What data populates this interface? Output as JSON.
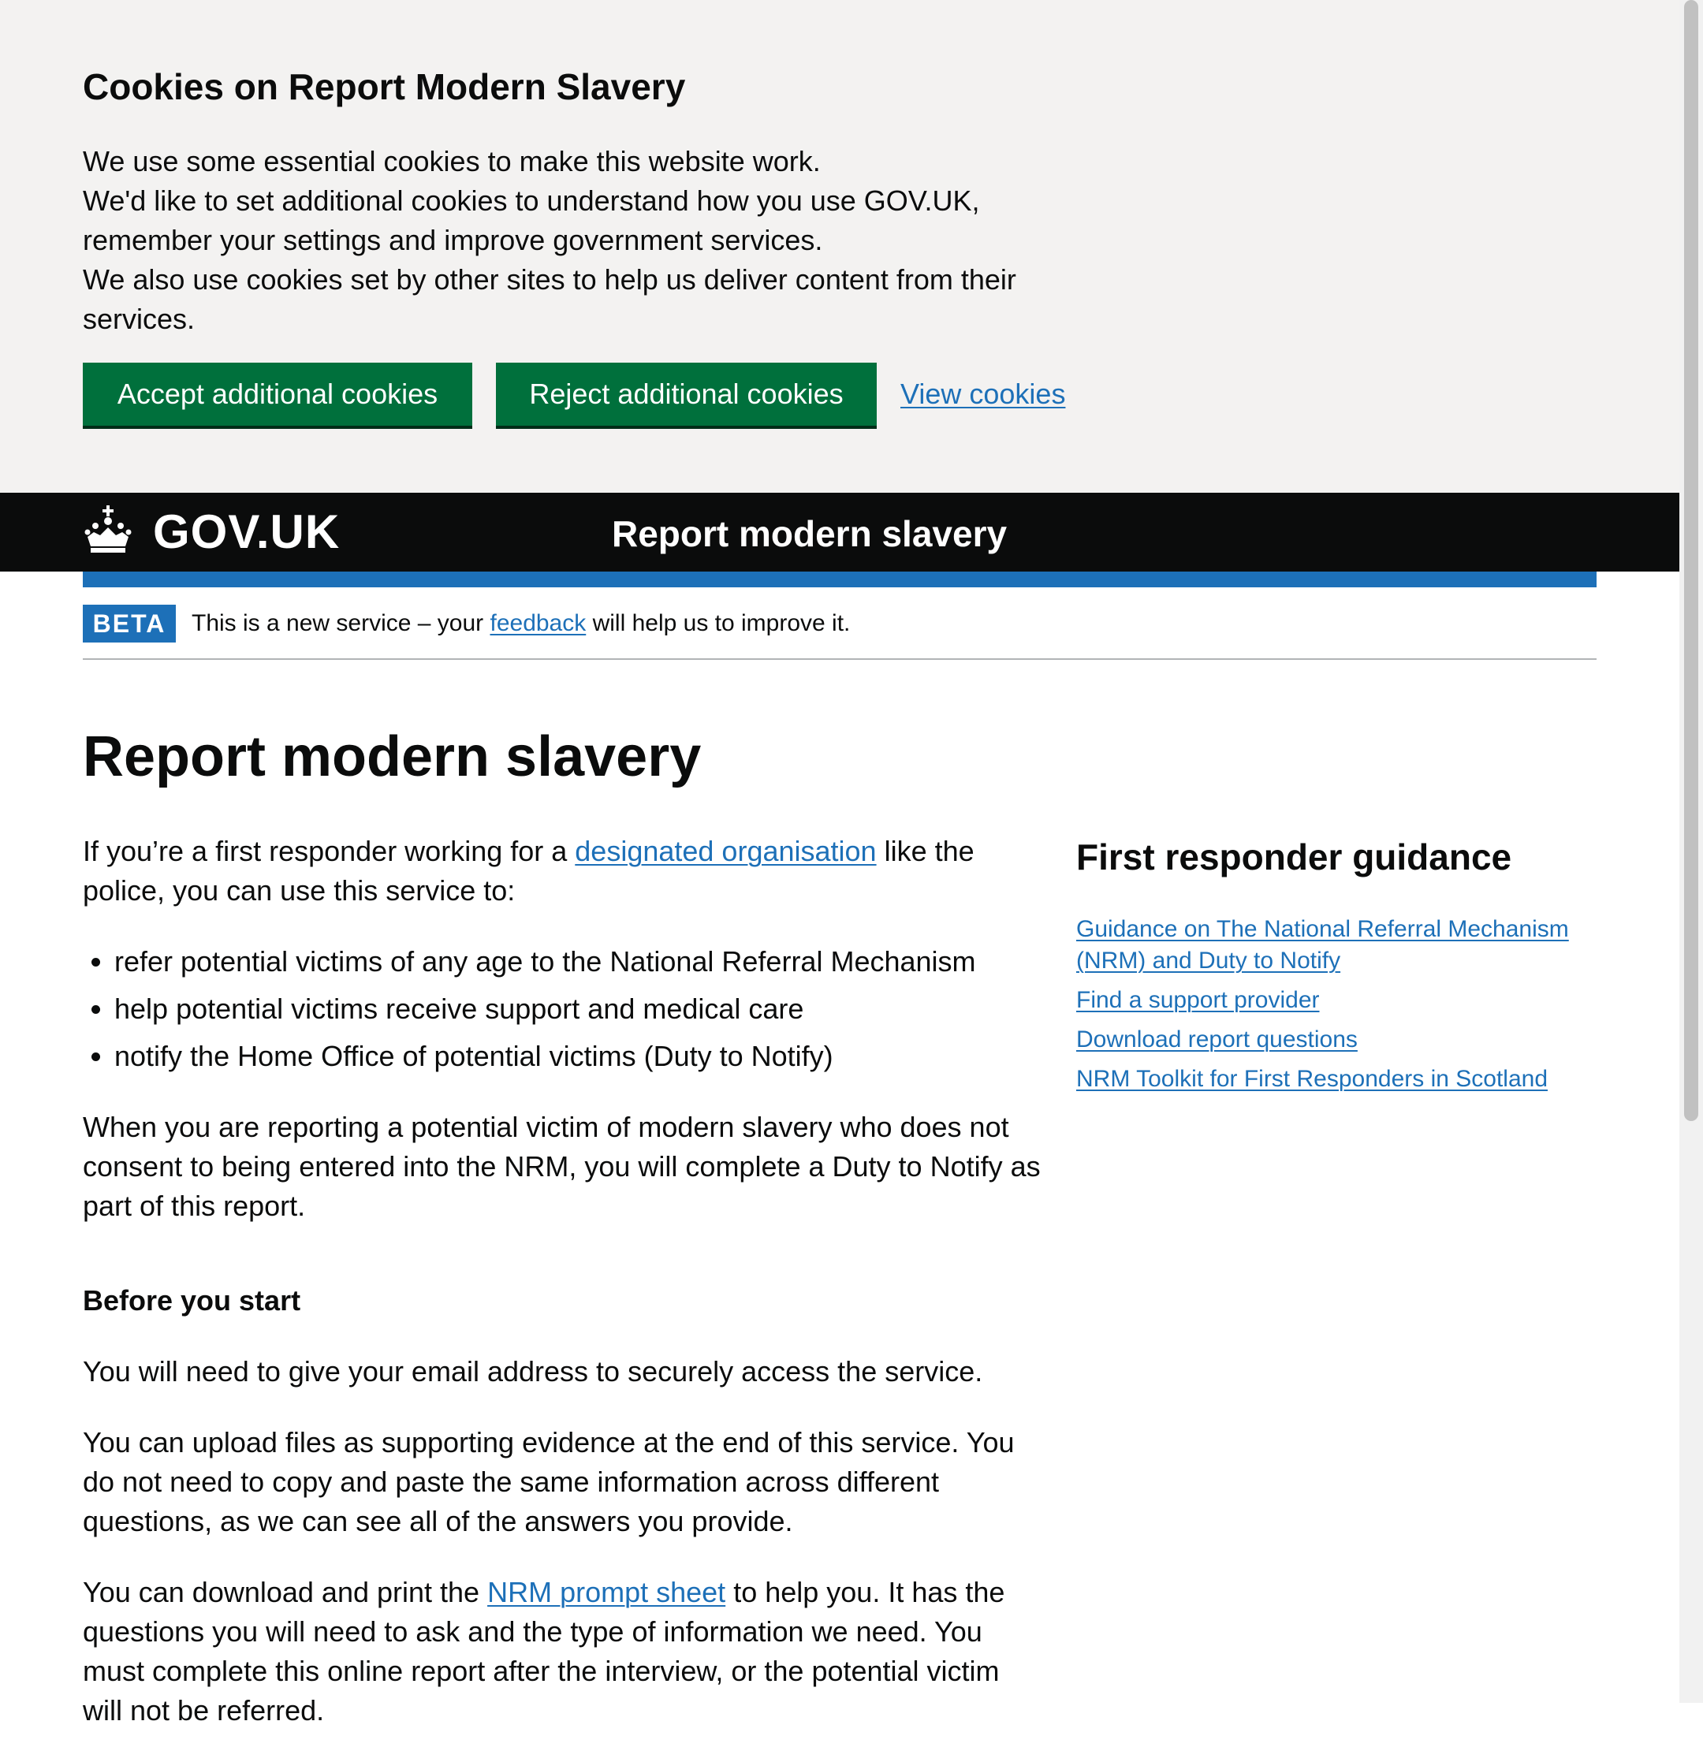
{
  "cookie_banner": {
    "title": "Cookies on Report Modern Slavery",
    "line1": "We use some essential cookies to make this website work.",
    "line2": "We'd like to set additional cookies to understand how you use GOV.UK, remember your settings and improve government services.",
    "line3": "We also use cookies set by other sites to help us deliver content from their services.",
    "accept_label": "Accept additional cookies",
    "reject_label": "Reject additional cookies",
    "view_label": "View cookies"
  },
  "header": {
    "logo_text": "GOV.UK",
    "service_name": "Report modern slavery",
    "crown_icon": "crown-icon"
  },
  "phase_banner": {
    "tag": "BETA",
    "text_before": "This is a new service – your ",
    "link": "feedback",
    "text_after": " will help us to improve it."
  },
  "main": {
    "title": "Report modern slavery",
    "intro_before": "If you’re a first responder working for a ",
    "intro_link": "designated organisation",
    "intro_after": " like the police, you can use this service to:",
    "bullets": [
      "refer potential victims of any age to the National Referral Mechanism",
      "help potential victims receive support and medical care",
      "notify the Home Office of potential victims (Duty to Notify)"
    ],
    "duty_para": "When you are reporting a potential victim of modern slavery who does not consent to being entered into the NRM, you will complete a Duty to Notify as part of this report.",
    "before_heading": "Before you start",
    "email_para": "You will need to give your email address to securely access the service.",
    "upload_para": "You can upload files as supporting evidence at the end of this service. You do not need to copy and paste the same information across different questions, as we can see all of the answers you provide.",
    "prompt_before": "You can download and print the ",
    "prompt_link": "NRM prompt sheet",
    "prompt_after": " to help you. It has the questions you will need to ask and the type of information we need. You must complete this online report after the interview, or the potential victim will not be referred."
  },
  "sidebar": {
    "title": "First responder guidance",
    "links": [
      "Guidance on The National Referral Mechanism (NRM) and Duty to Notify",
      "Find a support provider",
      "Download report questions",
      "NRM Toolkit for First Responders in Scotland"
    ]
  },
  "colors": {
    "brand_blue": "#1d70b8",
    "button_green": "#00703c",
    "header_black": "#0b0c0c",
    "banner_grey": "#f3f2f1"
  }
}
